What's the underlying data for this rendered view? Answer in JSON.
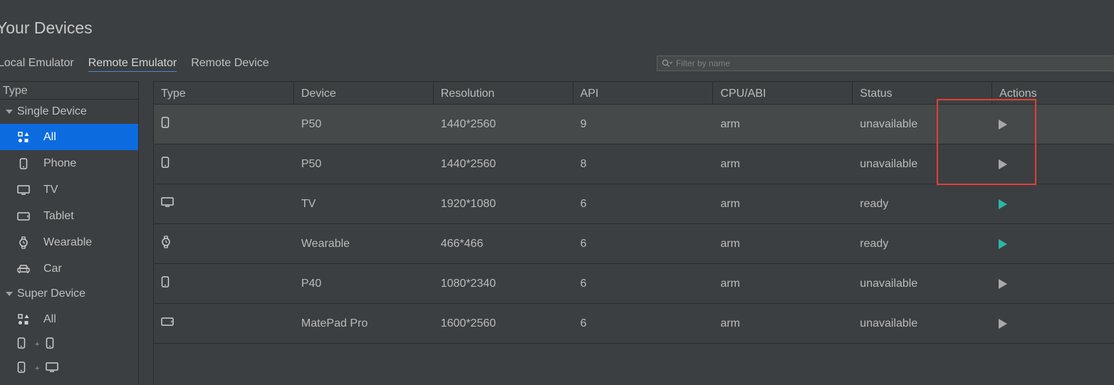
{
  "header": {
    "title": "Your Devices"
  },
  "tabs": [
    {
      "label": "Local Emulator",
      "active": false
    },
    {
      "label": "Remote Emulator",
      "active": true
    },
    {
      "label": "Remote Device",
      "active": false
    }
  ],
  "filter": {
    "placeholder": "Filter by name",
    "icon": "search-icon"
  },
  "sidebar": {
    "header": "Type",
    "groups": [
      {
        "label": "Single Device",
        "items": [
          {
            "label": "All",
            "icon": "grid-icon",
            "selected": true
          },
          {
            "label": "Phone",
            "icon": "phone-icon"
          },
          {
            "label": "TV",
            "icon": "tv-icon"
          },
          {
            "label": "Tablet",
            "icon": "tablet-icon"
          },
          {
            "label": "Wearable",
            "icon": "watch-icon"
          },
          {
            "label": "Car",
            "icon": "car-icon"
          }
        ]
      },
      {
        "label": "Super Device",
        "items": [
          {
            "label": "All",
            "icon": "grid-icon"
          },
          {
            "combo": [
              "phone-icon",
              "phone-icon"
            ],
            "plus": "+"
          },
          {
            "combo": [
              "phone-icon",
              "tv-icon"
            ],
            "plus": "+"
          }
        ]
      }
    ]
  },
  "table": {
    "columns": [
      "Type",
      "Device",
      "Resolution",
      "API",
      "CPU/ABI",
      "Status",
      "Actions"
    ],
    "rows": [
      {
        "type_icon": "phone-icon",
        "device": "P50",
        "resolution": "1440*2560",
        "api": "9",
        "cpu": "arm",
        "status": "unavailable",
        "action": "play-icon"
      },
      {
        "type_icon": "phone-icon",
        "device": "P50",
        "resolution": "1440*2560",
        "api": "8",
        "cpu": "arm",
        "status": "unavailable",
        "action": "play-icon"
      },
      {
        "type_icon": "tv-icon",
        "device": "TV",
        "resolution": "1920*1080",
        "api": "6",
        "cpu": "arm",
        "status": "ready",
        "action": "play-icon"
      },
      {
        "type_icon": "watch-icon",
        "device": "Wearable",
        "resolution": "466*466",
        "api": "6",
        "cpu": "arm",
        "status": "ready",
        "action": "play-icon"
      },
      {
        "type_icon": "phone-icon",
        "device": "P40",
        "resolution": "1080*2340",
        "api": "6",
        "cpu": "arm",
        "status": "unavailable",
        "action": "play-icon"
      },
      {
        "type_icon": "tablet-icon",
        "device": "MatePad Pro",
        "resolution": "1600*2560",
        "api": "6",
        "cpu": "arm",
        "status": "unavailable",
        "action": "play-icon"
      }
    ]
  },
  "colors": {
    "background": "#3c3f41",
    "selected": "#0d6be0",
    "ready_play": "#2cb5a8",
    "unavailable_play": "#a9a9a9",
    "highlight_box": "#e0403a"
  }
}
